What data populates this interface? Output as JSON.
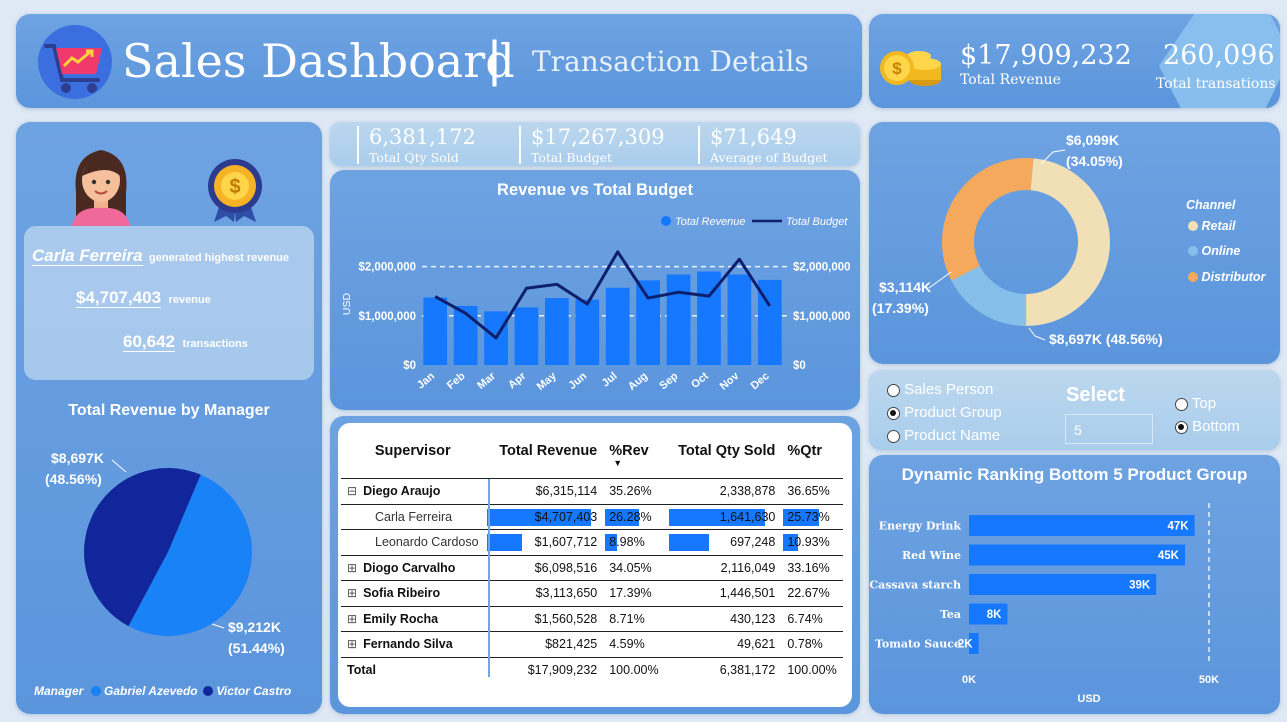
{
  "header": {
    "title": "Sales Dashboard",
    "separator": "|",
    "subtitle": "Transaction Details"
  },
  "totals": {
    "revenue_value": "$17,909,232",
    "revenue_label": "Total Revenue",
    "transactions_value": "260,096",
    "transactions_label": "Total transations"
  },
  "kpis": [
    {
      "value": "6,381,172",
      "label": "Total Qty Sold"
    },
    {
      "value": "$17,267,309",
      "label": "Total Budget"
    },
    {
      "value": "$71,649",
      "label": "Average of Budget"
    }
  ],
  "top_performer": {
    "name": "Carla Ferreira",
    "name_suffix": "generated highest revenue",
    "revenue": "$4,707,403",
    "revenue_suffix": "revenue",
    "transactions": "60,642",
    "transactions_suffix": "transactions"
  },
  "chart_data": [
    {
      "type": "bar",
      "title": "Revenue vs Total Budget",
      "ylabel": "USD",
      "categories": [
        "Jan",
        "Feb",
        "Mar",
        "Apr",
        "May",
        "Jun",
        "Jul",
        "Aug",
        "Sep",
        "Oct",
        "Nov",
        "Dec"
      ],
      "ylim": [
        0,
        2500000
      ],
      "yticks": [
        "$0",
        "$1,000,000",
        "$2,000,000"
      ],
      "legend": "top-right",
      "series": [
        {
          "name": "Total Revenue",
          "kind": "bar",
          "color": "#1677ff",
          "values": [
            1370000,
            1200000,
            1090000,
            1170000,
            1360000,
            1330000,
            1570000,
            1720000,
            1840000,
            1900000,
            1840000,
            1730000
          ]
        },
        {
          "name": "Total Budget",
          "kind": "line",
          "color": "#0e1f6b",
          "values": [
            1390000,
            1050000,
            550000,
            1560000,
            1640000,
            1240000,
            2300000,
            1360000,
            1480000,
            1400000,
            2150000,
            1200000
          ]
        }
      ]
    },
    {
      "type": "pie",
      "title": "Total Revenue by Manager",
      "legend_title": "Manager",
      "legend": "bottom",
      "series": [
        {
          "name": "Gabriel Azevedo",
          "value": 9212,
          "label": "$9,212K",
          "pct": "(51.44%)",
          "color": "#1a82f7"
        },
        {
          "name": "Victor Castro",
          "value": 8697,
          "label": "$8,697K",
          "pct": "(48.56%)",
          "color": "#12269c"
        }
      ]
    },
    {
      "type": "pie",
      "subtype": "donut",
      "legend_title": "Channel",
      "legend": "right",
      "series": [
        {
          "name": "Retail",
          "value": 8697,
          "label": "$8,697K (48.56%)",
          "color": "#f1dfb6"
        },
        {
          "name": "Online",
          "value": 3114,
          "label": "$3,114K",
          "label2": "(17.39%)",
          "color": "#86c0ea"
        },
        {
          "name": "Distributor",
          "value": 6099,
          "label": "$6,099K",
          "label2": "(34.05%)",
          "color": "#f5a95c"
        }
      ]
    },
    {
      "type": "bar",
      "orientation": "horizontal",
      "title": "Dynamic Ranking Bottom 5 Product Group",
      "xlabel": "USD",
      "xlim": [
        0,
        50000
      ],
      "xticks": [
        "0K",
        "50K"
      ],
      "categories": [
        "Energy Drink",
        "Red Wine",
        "Cassava starch",
        "Tea",
        "Tomato Sauce"
      ],
      "values": [
        47000,
        45000,
        39000,
        8000,
        2000
      ],
      "value_labels": [
        "47K",
        "45K",
        "39K",
        "8K",
        "2K"
      ],
      "color": "#1677ff"
    }
  ],
  "selector": {
    "options": [
      "Sales Person",
      "Product Group",
      "Product Name"
    ],
    "selected": "Product Group",
    "select_label": "Select",
    "select_value": "5",
    "order_options": [
      "Top",
      "Bottom"
    ],
    "order_selected": "Bottom"
  },
  "table": {
    "columns": [
      "Supervisor",
      "Total Revenue",
      "%Rev",
      "Total Qty Sold",
      "%Qtr"
    ],
    "sort_indicator": "▼",
    "rows": [
      {
        "expander": "⊟",
        "name": "Diego Araujo",
        "rev": "$6,315,114",
        "prev": "35.26%",
        "qty": "2,338,878",
        "pqty": "36.65%",
        "level": 0
      },
      {
        "expander": "",
        "name": "Carla Ferreira",
        "rev": "$4,707,403",
        "prev": "26.28%",
        "qty": "1,641,630",
        "pqty": "25.73%",
        "level": 1,
        "rev_frac": 1.0,
        "prev_frac": 1.0,
        "qty_frac": 1.0,
        "pqty_frac": 1.0
      },
      {
        "expander": "",
        "name": "Leonardo Cardoso",
        "rev": "$1,607,712",
        "prev": "8.98%",
        "qty": "697,248",
        "pqty": "10.93%",
        "level": 1,
        "rev_frac": 0.34,
        "prev_frac": 0.34,
        "qty_frac": 0.42,
        "pqty_frac": 0.42
      },
      {
        "expander": "⊞",
        "name": "Diogo Carvalho",
        "rev": "$6,098,516",
        "prev": "34.05%",
        "qty": "2,116,049",
        "pqty": "33.16%",
        "level": 0
      },
      {
        "expander": "⊞",
        "name": "Sofia Ribeiro",
        "rev": "$3,113,650",
        "prev": "17.39%",
        "qty": "1,446,501",
        "pqty": "22.67%",
        "level": 0
      },
      {
        "expander": "⊞",
        "name": "Emily Rocha",
        "rev": "$1,560,528",
        "prev": "8.71%",
        "qty": "430,123",
        "pqty": "6.74%",
        "level": 0
      },
      {
        "expander": "⊞",
        "name": "Fernando Silva",
        "rev": "$821,425",
        "prev": "4.59%",
        "qty": "49,621",
        "pqty": "0.78%",
        "level": 0
      }
    ],
    "total": {
      "name": "Total",
      "rev": "$17,909,232",
      "prev": "100.00%",
      "qty": "6,381,172",
      "pqty": "100.00%"
    }
  },
  "colors": {
    "accent": "#1677ff",
    "navy": "#0e1f6b",
    "panel": "#6ea3e2"
  },
  "icons": [
    "shopping-cart-icon",
    "coins-icon",
    "person-avatar-icon",
    "medal-icon"
  ]
}
